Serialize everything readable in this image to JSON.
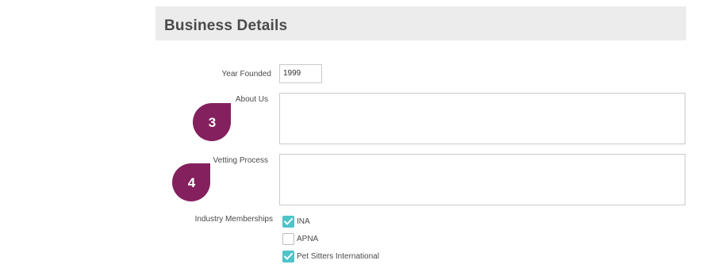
{
  "section": {
    "title": "Business Details"
  },
  "fields": {
    "year_founded": {
      "label": "Year Founded",
      "value": "1999"
    },
    "about_us": {
      "label": "About Us",
      "value": ""
    },
    "vetting_process": {
      "label": "Vetting Process",
      "value": ""
    }
  },
  "badges": {
    "about_us_step": "3",
    "vetting_step": "4"
  },
  "memberships": {
    "label": "Industry Memberships",
    "items": [
      {
        "label": "INA",
        "checked": true
      },
      {
        "label": "APNA",
        "checked": false
      },
      {
        "label": "Pet Sitters International",
        "checked": true
      }
    ]
  },
  "colors": {
    "badge": "#84205e",
    "checkbox_checked": "#4fc3c8",
    "header_bg": "#ececec"
  }
}
